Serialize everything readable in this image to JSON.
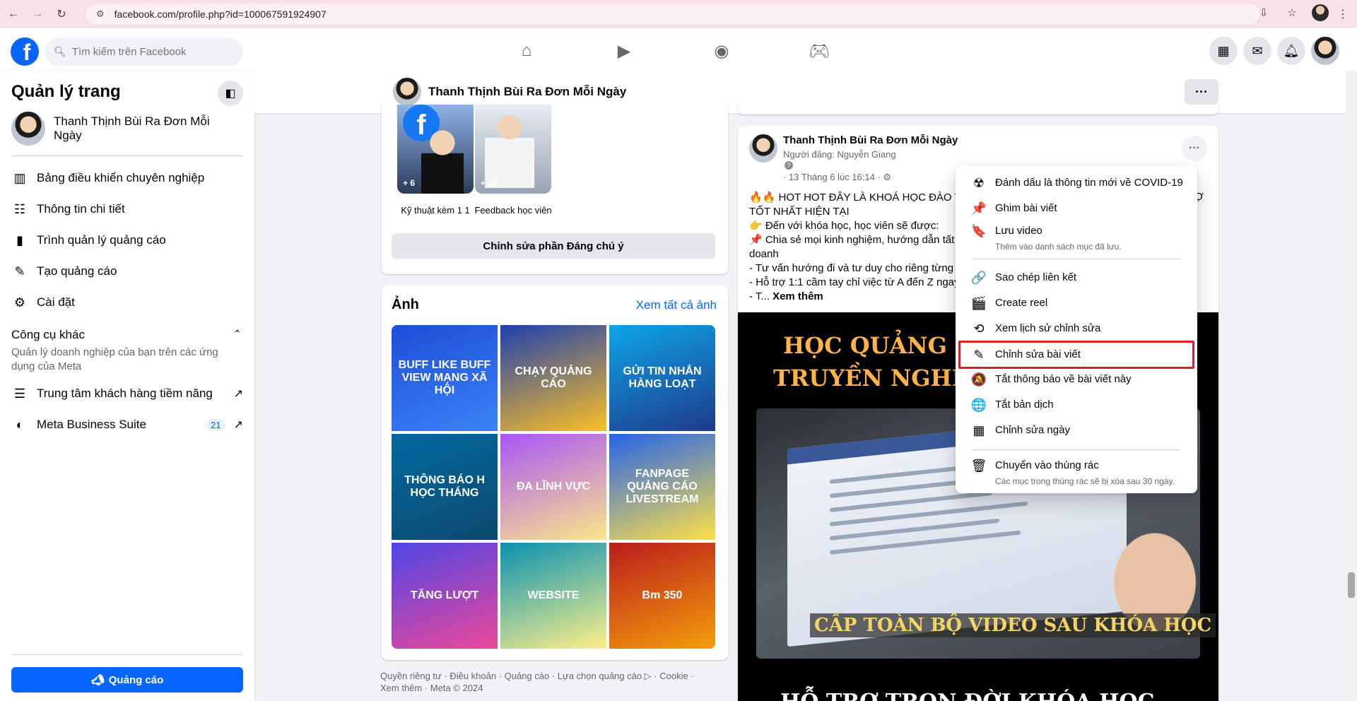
{
  "browser": {
    "url": "facebook.com/profile.php?id=100067591924907"
  },
  "header": {
    "search_placeholder": "Tìm kiếm trên Facebook",
    "logo_letter": "f"
  },
  "sidebar": {
    "title": "Quản lý trang",
    "page_name": "Thanh Thịnh Bùi Ra Đơn Mỗi Ngày",
    "items": [
      {
        "label": "Bảng điều khiển chuyên nghiệp"
      },
      {
        "label": "Thông tin chi tiết"
      },
      {
        "label": "Trình quản lý quảng cáo"
      },
      {
        "label": "Tạo quảng cáo"
      },
      {
        "label": "Cài đặt"
      }
    ],
    "other_tools_title": "Công cụ khác",
    "other_tools_desc": "Quản lý doanh nghiệp của bạn trên các ứng dụng của Meta",
    "other_items": [
      {
        "label": "Trung tâm khách hàng tiềm năng"
      },
      {
        "label": "Meta Business Suite",
        "badge": "21"
      }
    ],
    "ads_button": "Quảng cáo"
  },
  "pagebar": {
    "name": "Thanh Thịnh Bùi Ra Đơn Mỗi Ngày"
  },
  "featured": {
    "stories": [
      {
        "caption": "Kỹ thuật kèm 1 1",
        "count": "+ 6"
      },
      {
        "caption": "Feedback học viên",
        "count": "+ 12"
      }
    ],
    "edit_button": "Chỉnh sửa phần Đáng chú ý"
  },
  "photos": {
    "title": "Ảnh",
    "see_all": "Xem tất cả ảnh",
    "tiles": [
      {
        "text": "BUFF LIKE BUFF VIEW MẠNG XÃ HỘI",
        "colors": [
          "#1d4ed8",
          "#3b82f6"
        ]
      },
      {
        "text": "CHẠY QUẢNG CÁO",
        "colors": [
          "#1e40af",
          "#fbbf24"
        ]
      },
      {
        "text": "GỬI TIN NHẮN HÀNG LOẠT",
        "colors": [
          "#0ea5e9",
          "#1e3a8a"
        ]
      },
      {
        "text": "THÔNG BÁO H HỌC THÁNG",
        "colors": [
          "#0369a1",
          "#0c4a6e"
        ]
      },
      {
        "text": "ĐA LĨNH VỰC",
        "colors": [
          "#a855f7",
          "#fde68a"
        ]
      },
      {
        "text": "FANPAGE QUẢNG CÁO LIVESTREAM",
        "colors": [
          "#2563eb",
          "#fde047"
        ]
      },
      {
        "text": "TĂNG LƯỢT",
        "colors": [
          "#4f46e5",
          "#ec4899"
        ]
      },
      {
        "text": "WEBSITE",
        "colors": [
          "#0891b2",
          "#fef08a"
        ]
      },
      {
        "text": "Bm 350",
        "colors": [
          "#b91c1c",
          "#f59e0b"
        ]
      }
    ]
  },
  "footer": {
    "text": "Quyền riêng tư · Điều khoản · Quảng cáo · Lựa chọn quảng cáo ▷ · Cookie · Xem thêm · Meta © 2024"
  },
  "post": {
    "author": "Thanh Thịnh Bùi Ra Đơn Mỗi Ngày",
    "posted_by": "Người đăng: Nguyễn Giang",
    "date": "· 13 Tháng 6 lúc 16:14 ·",
    "lines": [
      "🔥🔥 HOT HOT ĐÂY LÀ KHOÁ HỌC ĐÀO TẠ",
      "TỐT NHẤT HIỆN TẠI",
      "👉 Đến với khóa học, học viên sẽ được:",
      "📌 Chia sẻ mọi kinh nghiệm, hướng dẫn tất",
      "doanh",
      "- Tư vấn hướng đi và tư duy cho riêng từng",
      "- Hỗ trợ 1:1 cầm tay chỉ việc từ A đến Z ngay"
    ],
    "last_line": "- T...",
    "see_more": "Xem thêm",
    "trailing": "Ợ",
    "image": {
      "title1": "HỌC QUẢNG CÁ",
      "title2": "TRUYỀN NGHỀ 10",
      "caption": "CẤP TOÀN BỘ VIDEO SAU KHÓA HỌC",
      "title3": "HỖ TRỢ TRỌN ĐỜI KHÓA HỌC"
    }
  },
  "menu": {
    "items": [
      {
        "icon": "covid-info-icon",
        "glyph": "☢",
        "label": "Đánh dấu là thông tin mới về COVID-19"
      },
      {
        "icon": "pin-icon",
        "glyph": "📌",
        "label": "Ghim bài viết"
      },
      {
        "icon": "bookmark-icon",
        "glyph": "🔖",
        "label": "Lưu video",
        "sub": "Thêm vào danh sách mục đã lưu."
      },
      {
        "icon": "link-icon",
        "glyph": "🔗",
        "label": "Sao chép liên kết"
      },
      {
        "icon": "reel-icon",
        "glyph": "🎬",
        "label": "Create reel"
      },
      {
        "icon": "history-icon",
        "glyph": "⟲",
        "label": "Xem lịch sử chỉnh sửa"
      },
      {
        "icon": "pencil-icon",
        "glyph": "✎",
        "label": "Chỉnh sửa bài viết"
      },
      {
        "icon": "bell-off-icon",
        "glyph": "🔕",
        "label": "Tắt thông báo về bài viết này"
      },
      {
        "icon": "globe-icon",
        "glyph": "🌐",
        "label": "Tắt bản dịch"
      },
      {
        "icon": "calendar-icon",
        "glyph": "▦",
        "label": "Chỉnh sửa ngày"
      },
      {
        "icon": "trash-icon",
        "glyph": "🗑",
        "label": "Chuyển vào thùng rác",
        "sub": "Các mục trong thùng rác sẽ bị xóa sau 30 ngày."
      }
    ]
  }
}
